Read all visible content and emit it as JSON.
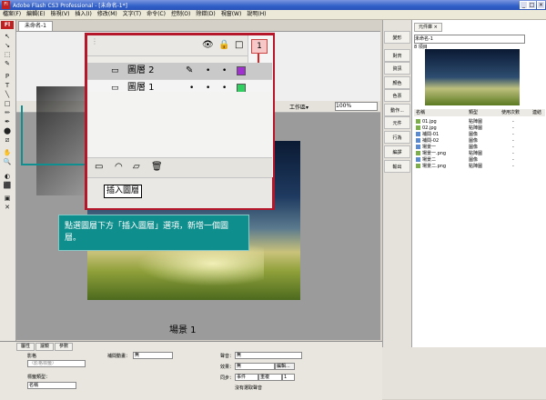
{
  "window": {
    "title": "Adobe Flash CS3 Professional - [未命名-1*]",
    "app_icon": "Fl",
    "controls": [
      "_",
      "□",
      "×"
    ]
  },
  "menu": [
    "檔案(F)",
    "編輯(E)",
    "檢視(V)",
    "插入(I)",
    "修改(M)",
    "文字(T)",
    "命令(C)",
    "控制(O)",
    "除錯(D)",
    "視窗(W)",
    "說明(H)"
  ],
  "tools": {
    "badge": "Fl",
    "glyphs": [
      "↖",
      "↘",
      "⬚",
      "✎",
      "P",
      "T",
      "╲",
      "□",
      "✏",
      "✒",
      "⬤",
      "⧄",
      "✋",
      "🔍",
      "◐",
      "⬛",
      "▣",
      "✕"
    ]
  },
  "document": {
    "tab": "未命名-1",
    "workspace_label": "工作區▾",
    "zoom": "100%"
  },
  "layers_panel": {
    "layers": [
      {
        "name": "圖層 2",
        "selected": true,
        "color": "#a030d0"
      },
      {
        "name": "圖層 1",
        "selected": false,
        "color": "#30d060"
      }
    ],
    "header_icons": {
      "eye": "👁",
      "lock": "🔒",
      "outline": "□",
      "frame": "1"
    },
    "tooltip": "插入圖層",
    "scene": "場景 1"
  },
  "instruction": "點選圖層下方「插入圖層」選項，新增一個圖層。",
  "right_strip": [
    "變形",
    "對齊",
    "資訊",
    "顏色",
    "色票",
    "動作...",
    "元件",
    "行為",
    "編譯",
    "輸出"
  ],
  "library": {
    "tab": "元件庫 ×",
    "doc_select": "未命名-1",
    "count": "8 項目",
    "headers": [
      "名稱",
      "類型",
      "使用次數",
      "連結"
    ],
    "items": [
      {
        "name": "01.jpg",
        "type": "點陣圖",
        "uses": "-"
      },
      {
        "name": "02.jpg",
        "type": "點陣圖",
        "uses": "-"
      },
      {
        "name": "補間-01",
        "type": "圖像",
        "uses": "-"
      },
      {
        "name": "補間-02",
        "type": "圖像",
        "uses": "-"
      },
      {
        "name": "場景一",
        "type": "圖像",
        "uses": "-"
      },
      {
        "name": "場景一.png",
        "type": "點陣圖",
        "uses": "-"
      },
      {
        "name": "場景二",
        "type": "圖像",
        "uses": "-"
      },
      {
        "name": "場景二.png",
        "type": "點陣圖",
        "uses": "-"
      }
    ]
  },
  "properties": {
    "tabs": [
      "屬性",
      "濾鏡",
      "參數"
    ],
    "frame_label": "影格",
    "frame_name_placeholder": "〈影格標籤〉",
    "label_type": "標籤類型：",
    "label_type_value": "名稱",
    "tween": "補間動畫：",
    "tween_value": "無",
    "sound": "聲音：",
    "sound_value": "無",
    "effect": "效果：",
    "effect_value": "無",
    "edit_btn": "編輯...",
    "sync": "同步：",
    "sync_value": "事件",
    "repeat_value": "重複",
    "repeat_count": "1",
    "no_sound": "沒有選取聲音"
  }
}
